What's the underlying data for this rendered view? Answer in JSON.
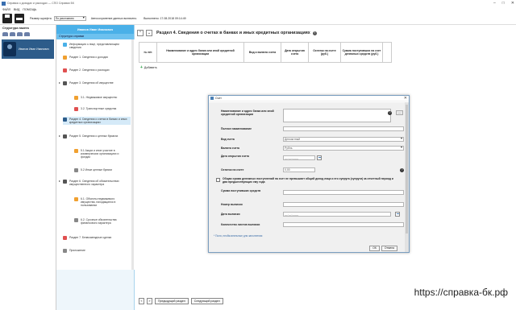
{
  "window": {
    "title": "Справка о доходах и расходах — СПО Справки БК",
    "controls": [
      "–",
      "□",
      "✕"
    ]
  },
  "menu": [
    "ФАЙЛ",
    "ВИД",
    "ПОМОЩЬ"
  ],
  "toolbar": {
    "font_size_label": "Размер шрифта",
    "font_size_value": "По умолчанию",
    "autosave_text": "Автосохранение данных включено.",
    "completed_text": "Выполнено: 17.08.2018 09:14:49"
  },
  "left_panel": {
    "title": "Структура пакета",
    "person_name": "Иванов Иван Иванович"
  },
  "nav": {
    "header": "Иванов Иван Иванович",
    "subheader": "Структура справки",
    "items": [
      {
        "label": "Информация о лице, представляющем сведения",
        "icon_color": "#4ab0e8"
      },
      {
        "label": "Раздел 1. Сведения о доходах",
        "icon_color": "#f0a030"
      },
      {
        "label": "Раздел 2. Сведения о расходах",
        "icon_color": "#e05050"
      },
      {
        "label": "Раздел 3. Сведения об имуществе",
        "icon_color": "#555555"
      },
      {
        "label": "3.1. Недвижимое имущество",
        "icon_color": "#f0a030"
      },
      {
        "label": "3.2. Транспортные средства",
        "icon_color": "#e05050"
      },
      {
        "label": "Раздел 4. Сведения о счетах в банках и иных кредитных организациях",
        "icon_color": "#2d5c8a"
      },
      {
        "label": "Раздел 5. Сведения о ценных бумагах",
        "icon_color": "#555555"
      },
      {
        "label": "5.1 Акции и иное участие в коммерческих организациях и фондах",
        "icon_color": "#f0a030"
      },
      {
        "label": "5.2 Иные ценные бумаги",
        "icon_color": "#888888"
      },
      {
        "label": "Раздел 6. Сведения об обязательствах имущественного характера",
        "icon_color": "#555555"
      },
      {
        "label": "6.1. Объекты недвижимого имущества, находящиеся в пользовании",
        "icon_color": "#f0a030"
      },
      {
        "label": "6.2. Срочные обязательства финансового характера",
        "icon_color": "#888888"
      },
      {
        "label": "Раздел 7. Безвозмездные сделки",
        "icon_color": "#e05050"
      },
      {
        "label": "Приложение",
        "icon_color": "#888888"
      }
    ]
  },
  "main": {
    "title": "Раздел 4. Сведения о счетах в банках и иных кредитных организациях",
    "columns": [
      "№ п/п",
      "Наименование и адрес банка или иной кредитной организации",
      "Вид и валюта счета",
      "Дата открытия счета",
      "Остаток на счете (руб.)",
      "Сумма поступивших на счет денежных средств (руб.)"
    ],
    "add_label": "Добавить"
  },
  "dialog": {
    "title": "Счет",
    "close": "✕",
    "fields": {
      "bank_name_label": "Наименование и адрес банка или иной кредитной организации",
      "full_name_label": "Полное наименование",
      "account_type_label": "Вид счета",
      "account_type_value": "Депозитный",
      "currency_label": "Валюта счета",
      "currency_value": "Рубль",
      "open_date_label": "Дата открытия счета",
      "date_placeholder": "__.__.____",
      "balance_label": "Остаток на счете",
      "balance_value": "0,00",
      "checkbox_label": "Общая сумма денежных поступлений на счет не превышает общий доход лица и его супруга (супруги) за отчетный период и два предшествующих ему года",
      "received_label": "Сумма поступивших средств",
      "statement_no_label": "Номер выписки",
      "statement_date_label": "Дата выписки",
      "sheets_label": "Количество листов выписки"
    },
    "required_note": "* Поля, необязательные для заполнения",
    "ok": "ОК",
    "cancel": "Отмена"
  },
  "footer": {
    "prev": "Предыдущий раздел",
    "next": "Следующий раздел"
  },
  "watermark": "https://справка-бк.рф"
}
